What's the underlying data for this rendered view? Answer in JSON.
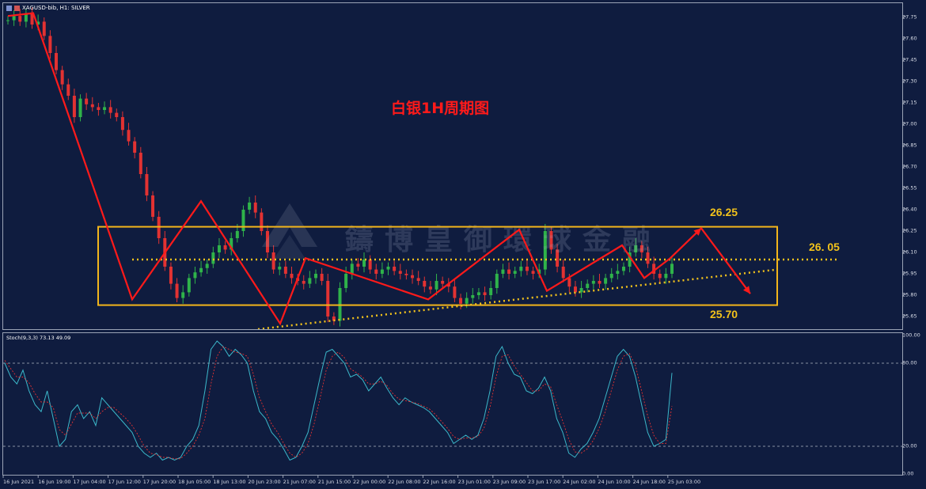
{
  "header": {
    "symbol_line": "XAGUSD-bib, H1:  SILVER"
  },
  "annotation": {
    "title": "白银1H周期图",
    "level_high": "26.25",
    "level_mid": "26. 05",
    "level_low": "25.70",
    "watermark": "鑄博皇御環球金融"
  },
  "colors": {
    "background": "#0f1c3f",
    "bull_candle": "#2fb34a",
    "bear_candle": "#e23232",
    "zigzag": "#ff1a1a",
    "box": "#f2b51b",
    "dotted": "#f2c21b",
    "stoch_main": "#3bb7c9",
    "stoch_signal": "#e23232"
  },
  "chart_data": [
    {
      "type": "line",
      "title": "",
      "ylabel": "",
      "ylim": [
        25.55,
        27.85
      ],
      "y_ticks": [
        "27.75",
        "27.60",
        "27.45",
        "27.30",
        "27.15",
        "27.00",
        "26.85",
        "26.70",
        "26.55",
        "26.40",
        "26.25",
        "26.10",
        "25.95",
        "25.80",
        "25.65"
      ],
      "x_ticks": [
        "16 Jun 2021",
        "16 Jun 19:00",
        "17 Jun 04:00",
        "17 Jun 12:00",
        "17 Jun 20:00",
        "18 Jun 05:00",
        "18 Jun 13:00",
        "20 Jun 23:00",
        "21 Jun 07:00",
        "21 Jun 15:00",
        "22 Jun 00:00",
        "22 Jun 08:00",
        "22 Jun 16:00",
        "23 Jun 01:00",
        "23 Jun 09:00",
        "23 Jun 17:00",
        "24 Jun 02:00",
        "24 Jun 10:00",
        "24 Jun 18:00",
        "25 Jun 03:00"
      ],
      "series": [
        {
          "name": "price",
          "values": [
            27.73,
            27.76,
            27.72,
            27.78,
            27.7,
            27.72,
            27.62,
            27.5,
            27.38,
            27.28,
            27.2,
            27.05,
            27.18,
            27.14,
            27.12,
            27.1,
            27.12,
            27.08,
            27.05,
            26.96,
            26.88,
            26.8,
            26.65,
            26.5,
            26.35,
            26.2,
            26.0,
            25.88,
            25.78,
            25.82,
            25.92,
            25.96,
            25.99,
            26.02,
            26.1,
            26.15,
            26.12,
            26.2,
            26.25,
            26.4,
            26.45,
            26.38,
            26.25,
            26.1,
            25.98,
            26.0,
            25.95,
            25.92,
            25.9,
            25.88,
            25.92,
            25.95,
            25.9,
            25.65,
            25.62,
            25.85,
            25.95,
            26.02,
            26.0,
            26.05,
            25.98,
            25.95,
            25.98,
            26.0,
            25.97,
            25.95,
            25.94,
            25.92,
            25.9,
            25.86,
            25.84,
            25.9,
            25.88,
            25.86,
            25.78,
            25.74,
            25.78,
            25.8,
            25.82,
            25.8,
            25.85,
            25.95,
            25.98,
            25.95,
            25.97,
            26.0,
            25.97,
            25.95,
            25.98,
            26.25,
            26.12,
            26.0,
            25.92,
            25.86,
            25.82,
            25.85,
            25.88,
            25.9,
            25.88,
            25.92,
            25.95,
            25.97,
            26.0,
            26.1,
            26.15,
            26.1,
            26.02,
            25.95,
            25.92,
            25.95,
            26.02
          ]
        }
      ]
    },
    {
      "type": "line",
      "title": "Stoch(9,3,3) 73.13 49.09",
      "ylim": [
        0,
        100
      ],
      "y_ticks": [
        "100.00",
        "80.00",
        "20.00",
        "0.00"
      ],
      "levels": [
        80,
        20
      ],
      "series": [
        {
          "name": "main",
          "values": [
            80,
            70,
            65,
            75,
            60,
            50,
            45,
            60,
            40,
            20,
            25,
            45,
            50,
            40,
            45,
            35,
            55,
            50,
            45,
            40,
            35,
            30,
            20,
            15,
            12,
            15,
            10,
            12,
            10,
            12,
            20,
            25,
            35,
            60,
            90,
            96,
            92,
            85,
            90,
            86,
            80,
            60,
            45,
            40,
            30,
            25,
            18,
            10,
            12,
            20,
            30,
            50,
            70,
            88,
            90,
            85,
            80,
            70,
            72,
            68,
            60,
            65,
            70,
            62,
            55,
            50,
            55,
            52,
            50,
            48,
            45,
            40,
            35,
            30,
            22,
            25,
            28,
            25,
            28,
            40,
            60,
            85,
            92,
            80,
            72,
            70,
            60,
            58,
            62,
            70,
            60,
            40,
            30,
            15,
            12,
            18,
            22,
            30,
            40,
            55,
            70,
            85,
            90,
            85,
            70,
            50,
            30,
            20,
            22,
            25,
            73
          ]
        },
        {
          "name": "signal",
          "values": [
            82,
            76,
            70,
            70,
            66,
            58,
            52,
            52,
            48,
            32,
            28,
            36,
            44,
            44,
            44,
            40,
            45,
            48,
            48,
            44,
            40,
            35,
            28,
            20,
            15,
            14,
            12,
            12,
            11,
            11,
            15,
            20,
            28,
            40,
            65,
            85,
            92,
            90,
            88,
            87,
            85,
            72,
            55,
            45,
            36,
            30,
            22,
            15,
            12,
            15,
            22,
            36,
            55,
            75,
            85,
            88,
            84,
            76,
            73,
            70,
            65,
            65,
            67,
            64,
            58,
            54,
            53,
            52,
            51,
            49,
            47,
            43,
            38,
            33,
            27,
            25,
            26,
            26,
            27,
            33,
            48,
            70,
            85,
            86,
            78,
            72,
            66,
            60,
            60,
            65,
            63,
            50,
            38,
            25,
            16,
            15,
            18,
            24,
            33,
            45,
            60,
            75,
            85,
            87,
            78,
            60,
            42,
            28,
            22,
            22,
            49
          ]
        }
      ]
    }
  ]
}
